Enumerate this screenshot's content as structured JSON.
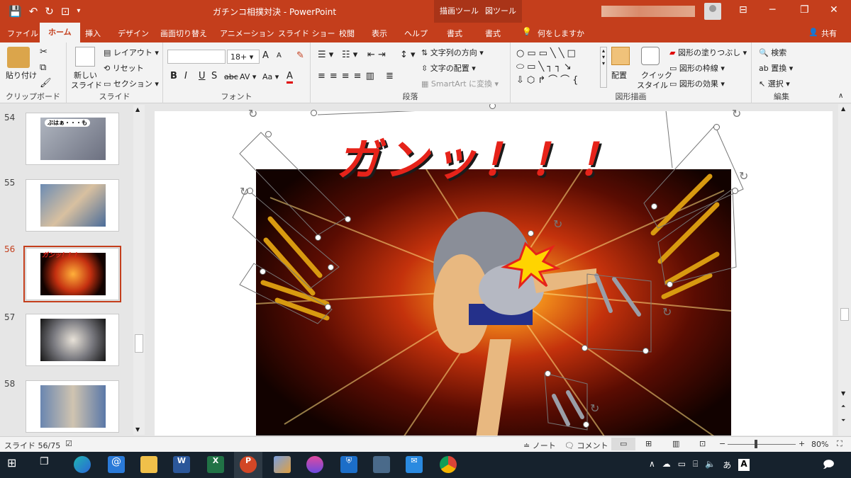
{
  "window": {
    "title": "ガチンコ相撲対決 - PowerPoint",
    "context_tab_drawing": "描画ツール",
    "context_tab_picture": "図ツール"
  },
  "tabs": [
    "ファイル",
    "ホーム",
    "挿入",
    "デザイン",
    "画面切り替え",
    "アニメーション",
    "スライド ショー",
    "校閲",
    "表示",
    "ヘルプ",
    "書式",
    "書式"
  ],
  "tell_me": "何をしますか",
  "share": "共有",
  "ribbon": {
    "clipboard": {
      "paste": "貼り付け",
      "label": "クリップボード"
    },
    "slides": {
      "new_slide_1": "新しい",
      "new_slide_2": "スライド",
      "layout": "レイアウト",
      "reset": "リセット",
      "section": "セクション",
      "label": "スライド"
    },
    "font": {
      "font_name": "",
      "font_size": "18+",
      "bold": "B",
      "italic": "I",
      "underline": "U",
      "shadow": "S",
      "strike": "abc",
      "spacing": "AV",
      "case": "Aa",
      "color": "A",
      "grow": "A",
      "shrink": "A",
      "label": "フォント"
    },
    "paragraph": {
      "text_direction": "文字列の方向",
      "align_text": "文字の配置",
      "smartart": "SmartArt に変換",
      "label": "段落"
    },
    "drawing": {
      "arrange": "配置",
      "quick_style_1": "クイック",
      "quick_style_2": "スタイル",
      "fill": "図形の塗りつぶし",
      "outline": "図形の枠線",
      "effects": "図形の効果",
      "label": "図形描画"
    },
    "editing": {
      "find": "検索",
      "replace": "置換",
      "select": "選択",
      "label": "編集"
    }
  },
  "thumbnails": [
    {
      "num": "54",
      "caption": "ぶはぁ・・・も",
      "selected": false
    },
    {
      "num": "55",
      "caption": "",
      "selected": false
    },
    {
      "num": "56",
      "caption": "ガンッ！！！",
      "selected": true
    },
    {
      "num": "57",
      "caption": "",
      "selected": false
    },
    {
      "num": "58",
      "caption": "",
      "selected": false
    }
  ],
  "slide": {
    "headline": "ガンッ！！！"
  },
  "status": {
    "slide_info": "スライド 56/75",
    "notes": "ノート",
    "comments": "コメント",
    "zoom": "80%"
  },
  "tray": {
    "ime": "あ",
    "letter": "A"
  },
  "colors": {
    "accent": "#c43e1c",
    "taskbar": "#16222d",
    "headline": "#e6231a"
  },
  "icons": [
    "save-icon",
    "undo-icon",
    "redo-icon",
    "present-icon",
    "lightbulb-icon",
    "person-icon",
    "search-icon",
    "windows-start-icon",
    "task-view-icon",
    "edge-icon",
    "mail-icon",
    "folder-icon",
    "word-icon",
    "excel-icon",
    "powerpoint-icon",
    "paint-icon",
    "drop-icon",
    "shield-icon",
    "calculator-icon",
    "chrome-icon"
  ]
}
